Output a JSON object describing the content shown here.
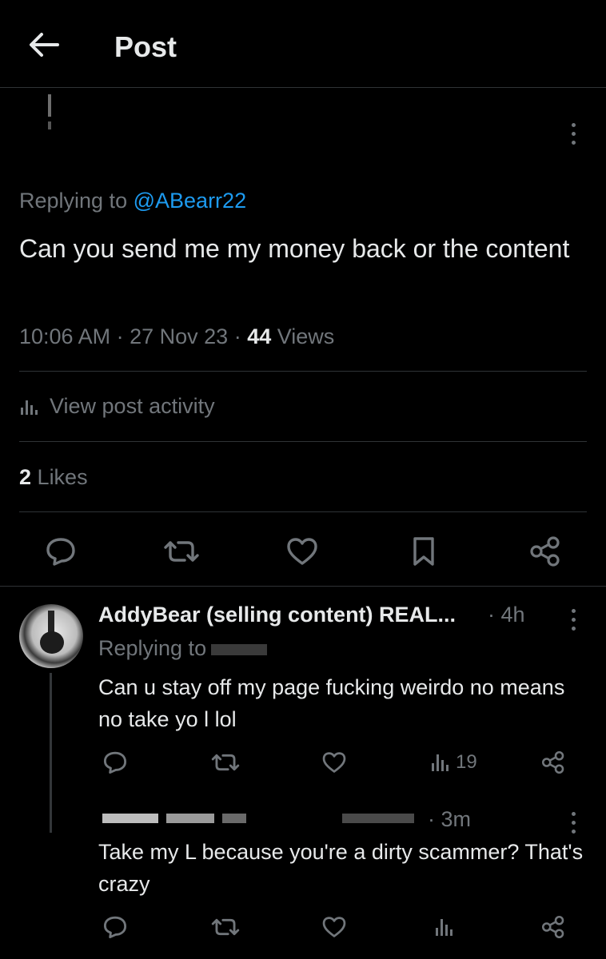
{
  "header": {
    "title": "Post",
    "back_icon": "arrow-left-icon"
  },
  "post": {
    "replying_prefix": "Replying to",
    "replying_handle": "@ABearr22",
    "text": "Can you send me my money back or the content",
    "time": "10:06 AM",
    "date": "27 Nov 23",
    "views_count": "44",
    "views_label": "Views",
    "activity_label": "View post activity",
    "likes_count": "2",
    "likes_label": "Likes"
  },
  "reply1": {
    "name": "AddyBear (selling content) REAL...",
    "time": "4h",
    "replying_prefix": "Replying to",
    "text": "Can u stay off my page fucking weirdo no means no take yo l lol",
    "views": "19"
  },
  "reply2": {
    "time": "3m",
    "text": "Take my L because you're a dirty scammer? That's crazy"
  },
  "colors": {
    "background": "#000000",
    "text": "#e7e9ea",
    "muted": "#71767b",
    "link": "#1d9bf0",
    "border": "#2f3336"
  }
}
